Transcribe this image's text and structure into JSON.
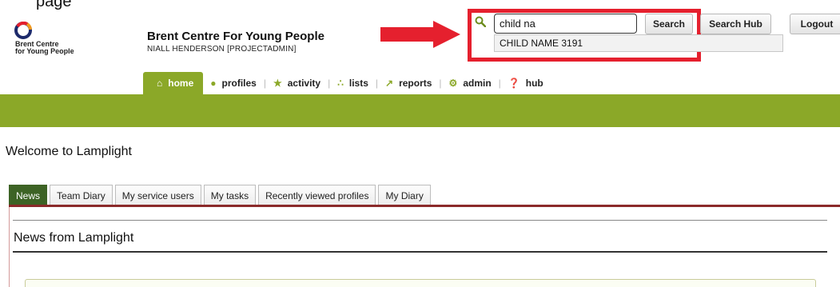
{
  "page": {
    "partial_heading": "page"
  },
  "header": {
    "logo_line1": "Brent Centre",
    "logo_line2": "for Young People",
    "org_name": "Brent Centre For Young People",
    "user_line": "NIALL HENDERSON [PROJECTADMIN]"
  },
  "search": {
    "icon": "search-icon",
    "value": "child na",
    "suggestion": "CHILD NAME 3191",
    "search_button": "Search",
    "hub_button": "Search Hub"
  },
  "logout_label": "Logout",
  "colors": {
    "brand_green": "#8ba828",
    "dark_green": "#3d6325",
    "annotation_red": "#e5202e",
    "tab_rule": "#8b2a2a"
  },
  "nav": {
    "items": [
      {
        "label": "home",
        "icon": "home-icon"
      },
      {
        "label": "profiles",
        "icon": "person-icon"
      },
      {
        "label": "activity",
        "icon": "star-icon"
      },
      {
        "label": "lists",
        "icon": "group-icon"
      },
      {
        "label": "reports",
        "icon": "chart-icon"
      },
      {
        "label": "admin",
        "icon": "cogs-icon"
      },
      {
        "label": "hub",
        "icon": "question-icon"
      }
    ]
  },
  "main": {
    "welcome": "Welcome to Lamplight",
    "tabs": [
      "News",
      "Team Diary",
      "My service users",
      "My tasks",
      "Recently viewed profiles",
      "My Diary"
    ],
    "news_heading": "News from Lamplight"
  }
}
